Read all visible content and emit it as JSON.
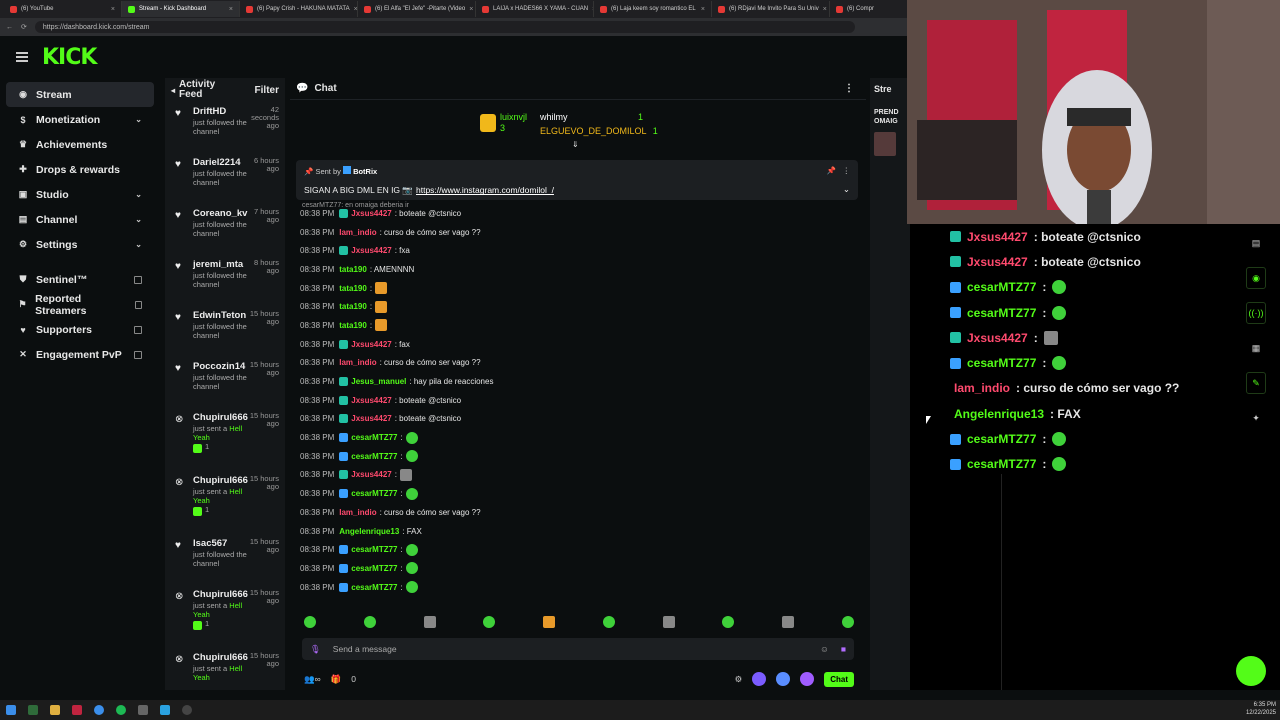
{
  "browser": {
    "tabs": [
      {
        "label": "(6) YouTube",
        "active": false
      },
      {
        "label": "Stream - Kick Dashboard",
        "active": true
      },
      {
        "label": "(6) Papy Crish - HAKUNA MATATA",
        "active": false
      },
      {
        "label": "(6) El Alfa \"El Jefe\" -Pitarte (Video",
        "active": false
      },
      {
        "label": "LAIJA x HADES66 X YAMA - CUAN",
        "active": false
      },
      {
        "label": "(6) Laja keem soy romantico EL",
        "active": false
      },
      {
        "label": "(6) RDjavi Me Invito Para Su Univ",
        "active": false
      },
      {
        "label": "(6) Compr",
        "active": false
      }
    ],
    "url": "https://dashboard.kick.com/stream"
  },
  "header": {
    "logo": "KICK"
  },
  "sidebar": {
    "items": [
      {
        "label": "Stream",
        "icon": "broadcast-icon",
        "active": true
      },
      {
        "label": "Monetization",
        "icon": "dollar-icon",
        "chevron": true
      },
      {
        "label": "Achievements",
        "icon": "trophy-icon"
      },
      {
        "label": "Drops & rewards",
        "icon": "gift-icon"
      },
      {
        "label": "Studio",
        "icon": "studio-icon",
        "chevron": true
      },
      {
        "label": "Channel",
        "icon": "channel-icon",
        "chevron": true
      },
      {
        "label": "Settings",
        "icon": "gear-icon",
        "chevron": true
      }
    ],
    "external": [
      {
        "label": "Sentinel™",
        "icon": "shield-icon"
      },
      {
        "label": "Reported Streamers",
        "icon": "flag-icon"
      },
      {
        "label": "Supporters",
        "icon": "heart-icon"
      },
      {
        "label": "Engagement PvP",
        "icon": "versus-icon"
      }
    ]
  },
  "feed": {
    "title": "Activity Feed",
    "filter": "Filter",
    "items": [
      {
        "name": "DriftHD",
        "time": "42 seconds ago",
        "text": "just followed the channel",
        "type": "follow"
      },
      {
        "name": "Dariel2214",
        "time": "6 hours ago",
        "text": "just followed the channel",
        "type": "follow"
      },
      {
        "name": "Coreano_kv",
        "time": "7 hours ago",
        "text": "just followed the channel",
        "type": "follow"
      },
      {
        "name": "jeremi_mta",
        "time": "8 hours ago",
        "text": "just followed the channel",
        "type": "follow"
      },
      {
        "name": "EdwinTeton",
        "time": "15 hours ago",
        "text": "just followed the channel",
        "type": "follow"
      },
      {
        "name": "Poccozin14",
        "time": "15 hours ago",
        "text": "just followed the channel",
        "type": "follow"
      },
      {
        "name": "Chupirul666",
        "time": "15 hours ago",
        "text": "just sent a",
        "extra": "Hell Yeah",
        "count": "1",
        "type": "sub"
      },
      {
        "name": "Chupirul666",
        "time": "15 hours ago",
        "text": "just sent a",
        "extra": "Hell Yeah",
        "count": "1",
        "type": "sub"
      },
      {
        "name": "Isac567",
        "time": "15 hours ago",
        "text": "just followed the channel",
        "type": "follow"
      },
      {
        "name": "Chupirul666",
        "time": "15 hours ago",
        "text": "just sent a",
        "extra": "Hell Yeah",
        "count": "1",
        "type": "sub"
      },
      {
        "name": "Chupirul666",
        "time": "15 hours ago",
        "text": "just sent a",
        "extra": "Hell Yeah",
        "type": "sub"
      }
    ]
  },
  "chat": {
    "title": "Chat",
    "leaderboard": {
      "left_name": "luixnvjl",
      "left_count": "3",
      "right": [
        {
          "name": "whilmy",
          "count": "1"
        },
        {
          "name": "ELGUEVO_DE_DOMILOL",
          "count": "1"
        }
      ]
    },
    "pinned": {
      "sent_by_label": "Sent by",
      "sender": "BotRix",
      "text": "SIGAN A BIG DML EN IG 📷",
      "link": "https://www.instagram.com/domilol_/"
    },
    "partial_message": "cesarMTZ77: en omaiga deberia ir",
    "messages": [
      {
        "time": "08:38 PM",
        "user": "Jxsus4427",
        "color": "#ff4a6e",
        "badge": "b",
        "text": ": boteate @ctsnico"
      },
      {
        "time": "08:38 PM",
        "user": "Iam_indio",
        "color": "#ff4a6e",
        "badge": "",
        "text": ": curso de cómo ser vago ??"
      },
      {
        "time": "08:38 PM",
        "user": "Jxsus4427",
        "color": "#ff4a6e",
        "badge": "b",
        "text": ": fxa"
      },
      {
        "time": "08:38 PM",
        "user": "tata190",
        "color": "#53fc18",
        "badge": "",
        "text": ": AMENNNN"
      },
      {
        "time": "08:38 PM",
        "user": "tata190",
        "color": "#53fc18",
        "badge": "",
        "text": ":",
        "emote": "f"
      },
      {
        "time": "08:38 PM",
        "user": "tata190",
        "color": "#53fc18",
        "badge": "",
        "text": ":",
        "emote": "f"
      },
      {
        "time": "08:38 PM",
        "user": "tata190",
        "color": "#53fc18",
        "badge": "",
        "text": ":",
        "emote": "f"
      },
      {
        "time": "08:38 PM",
        "user": "Jxsus4427",
        "color": "#ff4a6e",
        "badge": "b",
        "text": ": fax"
      },
      {
        "time": "08:38 PM",
        "user": "Iam_indio",
        "color": "#ff4a6e",
        "badge": "",
        "text": ": curso de cómo ser vago ??"
      },
      {
        "time": "08:38 PM",
        "user": "Jesus_manuel",
        "color": "#53fc18",
        "badge": "b",
        "text": ": hay pila de reacciones"
      },
      {
        "time": "08:38 PM",
        "user": "Jxsus4427",
        "color": "#ff4a6e",
        "badge": "b",
        "text": ": boteate @ctsnico"
      },
      {
        "time": "08:38 PM",
        "user": "Jxsus4427",
        "color": "#ff4a6e",
        "badge": "b",
        "text": ": boteate @ctsnico"
      },
      {
        "time": "08:38 PM",
        "user": "cesarMTZ77",
        "color": "#53fc18",
        "badge": "a",
        "text": ":",
        "emote": "g"
      },
      {
        "time": "08:38 PM",
        "user": "cesarMTZ77",
        "color": "#53fc18",
        "badge": "a",
        "text": ":",
        "emote": "g"
      },
      {
        "time": "08:38 PM",
        "user": "Jxsus4427",
        "color": "#ff4a6e",
        "badge": "b",
        "text": ":",
        "emote": "p"
      },
      {
        "time": "08:38 PM",
        "user": "cesarMTZ77",
        "color": "#53fc18",
        "badge": "a",
        "text": ":",
        "emote": "g"
      },
      {
        "time": "08:38 PM",
        "user": "Iam_indio",
        "color": "#ff4a6e",
        "badge": "",
        "text": ": curso de cómo ser vago ??"
      },
      {
        "time": "08:38 PM",
        "user": "Angelenrique13",
        "color": "#53fc18",
        "badge": "",
        "text": ": FAX"
      },
      {
        "time": "08:38 PM",
        "user": "cesarMTZ77",
        "color": "#53fc18",
        "badge": "a",
        "text": ":",
        "emote": "g"
      },
      {
        "time": "08:38 PM",
        "user": "cesarMTZ77",
        "color": "#53fc18",
        "badge": "a",
        "text": ":",
        "emote": "g"
      },
      {
        "time": "08:38 PM",
        "user": "cesarMTZ77",
        "color": "#53fc18",
        "badge": "a",
        "text": ":",
        "emote": "g"
      }
    ],
    "input_placeholder": "Send a message",
    "footer_count": "0",
    "chat_button": "Chat"
  },
  "right_panel": {
    "title": "Stre",
    "label": "PREND OMAIG"
  },
  "overlay": {
    "messages": [
      {
        "user": "Jxsus4427",
        "color": "#ff4a6e",
        "badge": "#22c1a4",
        "text": ": boteate @ctsnico"
      },
      {
        "user": "Jxsus4427",
        "color": "#ff4a6e",
        "badge": "#22c1a4",
        "text": ": boteate @ctsnico"
      },
      {
        "user": "cesarMTZ77",
        "color": "#53fc18",
        "badge": "#3aa0ff",
        "text": ":",
        "emote": "g"
      },
      {
        "user": "cesarMTZ77",
        "color": "#53fc18",
        "badge": "#3aa0ff",
        "text": ":",
        "emote": "g"
      },
      {
        "user": "Jxsus4427",
        "color": "#ff4a6e",
        "badge": "#22c1a4",
        "text": ":",
        "emote": "p"
      },
      {
        "user": "cesarMTZ77",
        "color": "#53fc18",
        "badge": "#3aa0ff",
        "text": ":",
        "emote": "g"
      },
      {
        "user": "Iam_indio",
        "color": "#ff4a6e",
        "badge": "",
        "text": ": curso de cómo ser vago ??"
      },
      {
        "user": "Angelenrique13",
        "color": "#53fc18",
        "badge": "",
        "text": ": FAX"
      },
      {
        "user": "cesarMTZ77",
        "color": "#53fc18",
        "badge": "#3aa0ff",
        "text": ":",
        "emote": "g"
      },
      {
        "user": "cesarMTZ77",
        "color": "#53fc18",
        "badge": "#3aa0ff",
        "text": ":",
        "emote": "g"
      }
    ]
  },
  "tray": {
    "time": "6:35 PM",
    "date": "12/22/2025"
  },
  "colors": {
    "accent": "#53fc18",
    "red_user": "#ff4a6e"
  }
}
